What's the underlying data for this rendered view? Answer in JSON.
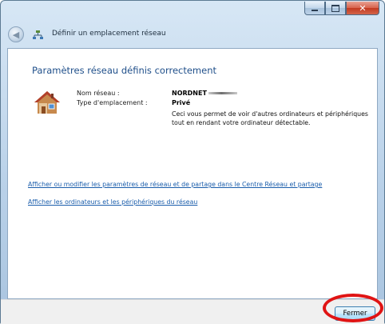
{
  "window": {
    "title": "Définir un emplacement réseau",
    "caption_buttons": [
      "minimize",
      "maximize",
      "close"
    ]
  },
  "icons": {
    "back": "back-arrow-icon",
    "network": "network-icon",
    "house": "home-location-icon"
  },
  "content": {
    "heading": "Paramètres réseau définis correctement",
    "network_name_label": "Nom réseau :",
    "network_name_value": "NORDNET",
    "location_type_label": "Type d'emplacement :",
    "location_type_value": "Privé",
    "location_description": "Ceci vous permet de voir d'autres ordinateurs et périphériques tout en rendant votre ordinateur détectable."
  },
  "links": {
    "sharing_center": "Afficher ou modifier les paramètres de réseau et de partage dans le Centre Réseau et partage",
    "view_devices": "Afficher les ordinateurs et les périphériques du réseau"
  },
  "footer": {
    "close_label": "Fermer"
  },
  "colors": {
    "heading": "#1f4f8a",
    "link": "#1a5dab",
    "highlight": "#e01414"
  }
}
